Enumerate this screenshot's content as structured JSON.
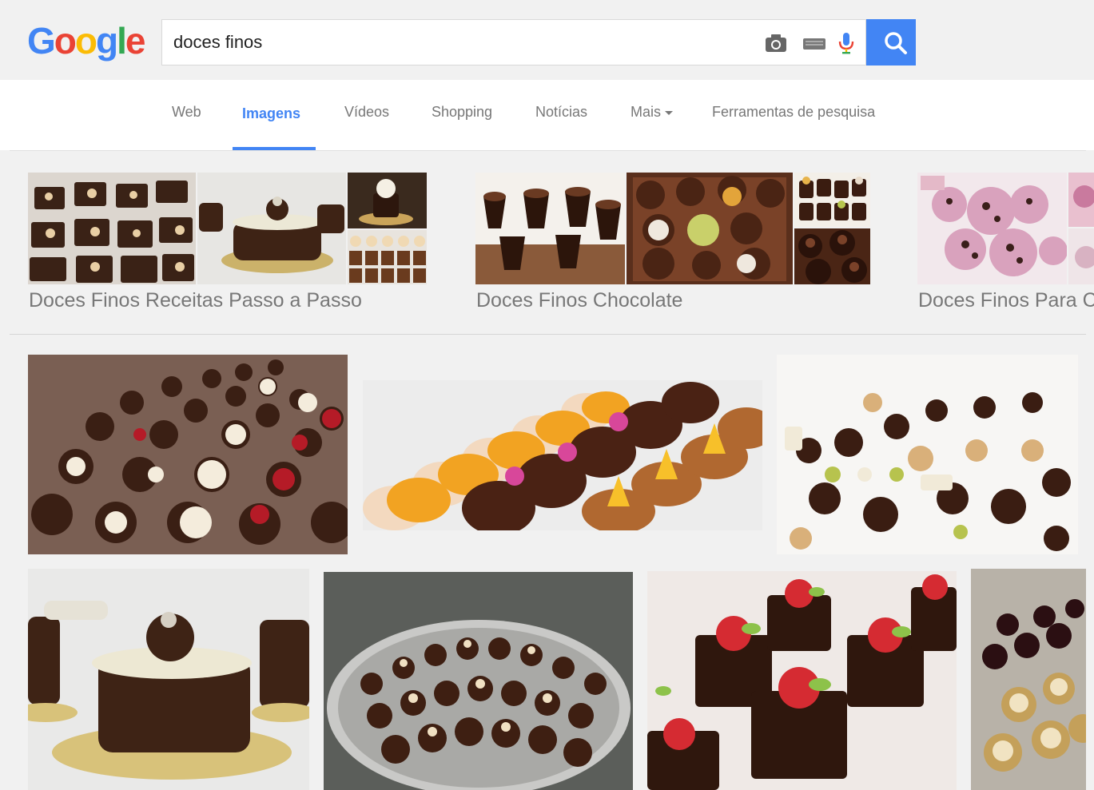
{
  "brand": {
    "logo_letters": [
      "G",
      "o",
      "o",
      "g",
      "l",
      "e"
    ]
  },
  "search": {
    "query": "doces finos"
  },
  "tabs": [
    {
      "label": "Web"
    },
    {
      "label": "Imagens"
    },
    {
      "label": "Vídeos"
    },
    {
      "label": "Shopping"
    },
    {
      "label": "Notícias"
    },
    {
      "label": "Mais"
    },
    {
      "label": "Ferramentas de pesquisa"
    }
  ],
  "related": [
    {
      "label": "Doces Finos Receitas Passo a Passo"
    },
    {
      "label": "Doces Finos Chocolate"
    },
    {
      "label": "Doces Finos Para Casamento"
    }
  ],
  "colors": {
    "accent": "#4285f4",
    "chocolate": "#3b1f14",
    "cream": "#f3ead8",
    "orange": "#f2a32a",
    "pink": "#d8479a",
    "red": "#c9202e"
  }
}
